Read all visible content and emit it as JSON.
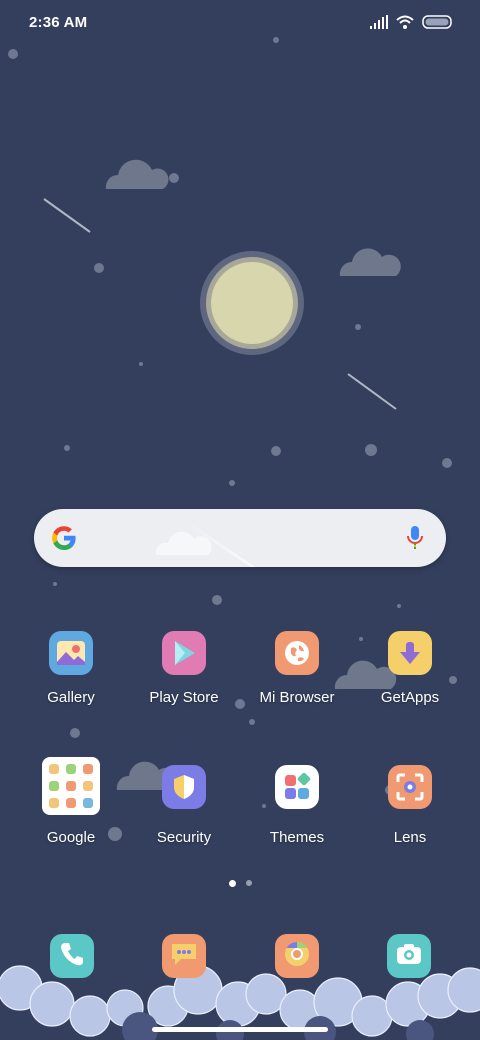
{
  "status_bar": {
    "time": "2:36 AM",
    "icons": [
      "signal-icon",
      "wifi-icon",
      "battery-icon"
    ]
  },
  "search": {
    "icons": [
      "google-g-icon",
      "microphone-icon"
    ]
  },
  "apps": [
    {
      "label": "Gallery",
      "icon": "gallery-icon",
      "color": "#5fa8e0"
    },
    {
      "label": "Play Store",
      "icon": "play-store-icon",
      "color": "#e07bb4"
    },
    {
      "label": "Mi Browser",
      "icon": "globe-icon",
      "color": "#f19a72"
    },
    {
      "label": "GetApps",
      "icon": "download-arrow-icon",
      "color": "#f5d06a"
    },
    {
      "label": "Google",
      "icon": "folder-icon",
      "color": "#ffffff"
    },
    {
      "label": "Security",
      "icon": "shield-icon",
      "color": "#7b7ce6"
    },
    {
      "label": "Themes",
      "icon": "themes-icon",
      "color": "#ffffff"
    },
    {
      "label": "Lens",
      "icon": "lens-icon",
      "color": "#f19a72"
    }
  ],
  "pages": {
    "count": 2,
    "active": 1
  },
  "dock": [
    {
      "name": "phone",
      "icon": "phone-icon",
      "color": "#5cc7c7"
    },
    {
      "name": "messages",
      "icon": "messages-icon",
      "color": "#f19a72"
    },
    {
      "name": "chrome",
      "icon": "chrome-icon",
      "color": "#f19a72"
    },
    {
      "name": "camera",
      "icon": "camera-icon",
      "color": "#5cc7c7"
    }
  ]
}
